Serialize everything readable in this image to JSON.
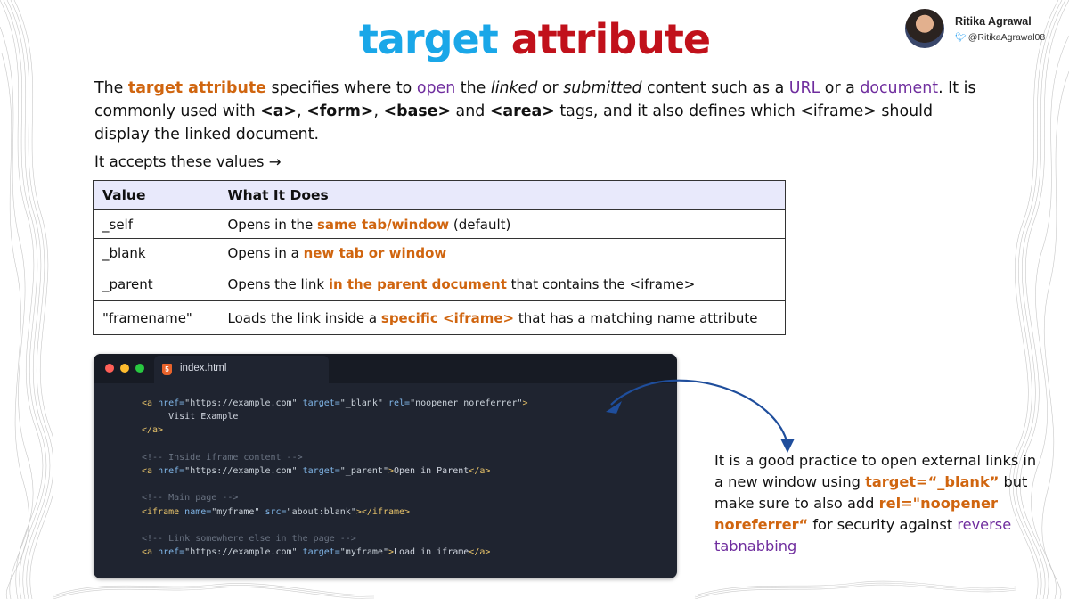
{
  "colors": {
    "title_blue": "#1aa7e8",
    "title_red": "#c1111b",
    "highlight_orange": "#d0650f",
    "highlight_purple": "#6f2d9e",
    "editor_bg": "#1f2430"
  },
  "header": {
    "title_part1": "target",
    "title_part2": "attribute"
  },
  "author": {
    "name": "Ritika Agrawal",
    "handle": "@RitikaAgrawal08",
    "icon": "twitter-bird-icon"
  },
  "intro": {
    "s1": "The ",
    "target_attribute": "target attribute",
    "s2": " specifies where to ",
    "open": "open",
    "s3": " the ",
    "linked": "linked",
    "s4": " or ",
    "submitted": "submitted",
    "s5": " content such as a ",
    "url": "URL",
    "s6": " or a ",
    "document": "document",
    "s7": ". It is commonly used with ",
    "tag_a": "<a>",
    "s8": ", ",
    "tag_form": "<form>",
    "s9": ", ",
    "tag_base": "<base>",
    "s10": " and ",
    "tag_area": "<area>",
    "s11": " tags, and it also defines which <iframe> should display the linked document."
  },
  "accepts": "It accepts these values →",
  "table": {
    "headers": [
      "Value",
      "What It Does"
    ],
    "rows": [
      {
        "value": "_self",
        "pre": "Opens in the ",
        "hl": "same tab/window",
        "post": " (default)"
      },
      {
        "value": "_blank",
        "pre": "Opens in a ",
        "hl": "new tab or window",
        "post": ""
      },
      {
        "value": "_parent",
        "pre": "Opens the link ",
        "hl": "in the parent document",
        "post": " that contains the <iframe>"
      },
      {
        "value": "\"framename\"",
        "pre": "Loads the link inside a ",
        "hl": "specific <iframe>",
        "post": " that has a matching name attribute"
      }
    ]
  },
  "editor": {
    "filename": "index.html",
    "code": {
      "l1": {
        "open": "<a",
        "a1": " href=",
        "v1": "\"https://example.com\"",
        "a2": " target=",
        "v2": "\"_blank\"",
        "a3": " rel=",
        "v3": "\"noopener noreferrer\"",
        "close": ">"
      },
      "l2": "     Visit Example",
      "l3": "</a>",
      "l4": "<!-- Inside iframe content -->",
      "l5": {
        "open": "<a",
        "a1": " href=",
        "v1": "\"https://example.com\"",
        "a2": " target=",
        "v2": "\"_parent\"",
        "close": ">",
        "text": "Open in Parent",
        "end": "</a>"
      },
      "l6": "<!-- Main page -->",
      "l7": {
        "open": "<iframe",
        "a1": " name=",
        "v1": "\"myframe\"",
        "a2": " src=",
        "v2": "\"about:blank\"",
        "close": "></iframe>"
      },
      "l8": "<!-- Link somewhere else in the page -->",
      "l9": {
        "open": "<a",
        "a1": " href=",
        "v1": "\"https://example.com\"",
        "a2": " target=",
        "v2": "\"myframe\"",
        "close": ">",
        "text": "Load in iframe",
        "end": "</a>"
      }
    }
  },
  "note": {
    "s1": "It is a good practice to open external links in a new window using ",
    "target_blank": "target=“_blank”",
    "s2": " but make sure to also add ",
    "rel": "rel=\"noopener noreferrer“",
    "s3": " for security against ",
    "reverse_tabnabbing": "reverse tabnabbing"
  }
}
